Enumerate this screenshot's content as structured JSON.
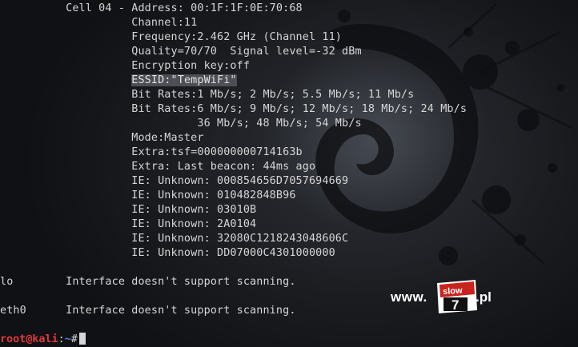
{
  "terminal": {
    "lines": [
      "          Cell 04 - Address: 00:1F:1F:0E:70:68",
      "                    Channel:11",
      "                    Frequency:2.462 GHz (Channel 11)",
      "                    Quality=70/70  Signal level=-32 dBm",
      "                    Encryption key:off",
      "ESSID:\"TempWiFi\"",
      "                    Bit Rates:1 Mb/s; 2 Mb/s; 5.5 Mb/s; 11 Mb/s",
      "                    Bit Rates:6 Mb/s; 9 Mb/s; 12 Mb/s; 18 Mb/s; 24 Mb/s",
      "                              36 Mb/s; 48 Mb/s; 54 Mb/s",
      "                    Mode:Master",
      "                    Extra:tsf=000000000714163b",
      "                    Extra: Last beacon: 44ms ago",
      "                    IE: Unknown: 000854656D7057694669",
      "                    IE: Unknown: 010482848B96",
      "                    IE: Unknown: 03010B",
      "                    IE: Unknown: 2A0104",
      "                    IE: Unknown: 32080C1218243048606C",
      "                    IE: Unknown: DD07000C4301000000",
      "",
      "lo        Interface doesn't support scanning.",
      "",
      "eth0      Interface doesn't support scanning.",
      ""
    ],
    "highlight_indent": "                    "
  },
  "prompt": {
    "user_host": "root@kali",
    "separator": ":",
    "path": "~",
    "symbol": "#"
  },
  "watermark": {
    "prefix": "www.",
    "box_top": "slow",
    "box_number": "7",
    "suffix": ".pl"
  },
  "colors": {
    "background": "#15171b",
    "text": "#d6d6d6",
    "prompt_user": "#e03a3a",
    "prompt_path": "#4f7ee0",
    "highlight": "#4d4f55",
    "watermark_red": "#c8231e"
  }
}
